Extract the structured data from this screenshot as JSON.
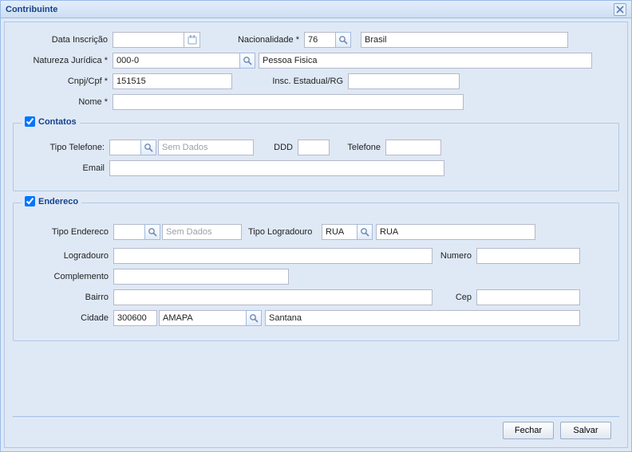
{
  "window": {
    "title": "Contribuinte"
  },
  "main": {
    "data_inscricao": {
      "label": "Data Inscrição",
      "value": ""
    },
    "nacionalidade": {
      "label": "Nacionalidade *",
      "code": "76",
      "name": "Brasil"
    },
    "natureza": {
      "label": "Natureza Jurídica *",
      "code": "000-0",
      "name": "Pessoa Fisica"
    },
    "cnpjcpf": {
      "label": "Cnpj/Cpf *",
      "value": "151515"
    },
    "insc": {
      "label": "Insc. Estadual/RG",
      "value": ""
    },
    "nome": {
      "label": "Nome *",
      "value": ""
    }
  },
  "contatos": {
    "legend": "Contatos",
    "checked": true,
    "tipo_telefone": {
      "label": "Tipo Telefone:",
      "code": "",
      "placeholder": "Sem Dados"
    },
    "ddd": {
      "label": "DDD",
      "value": ""
    },
    "telefone": {
      "label": "Telefone",
      "value": ""
    },
    "email": {
      "label": "Email",
      "value": ""
    }
  },
  "endereco": {
    "legend": "Endereco",
    "checked": true,
    "tipo_endereco": {
      "label": "Tipo Endereco",
      "code": "",
      "placeholder": "Sem Dados"
    },
    "tipo_logradouro": {
      "label": "Tipo Logradouro",
      "code": "RUA",
      "name": "RUA"
    },
    "logradouro": {
      "label": "Logradouro",
      "value": ""
    },
    "numero": {
      "label": "Numero",
      "value": ""
    },
    "complemento": {
      "label": "Complemento",
      "value": ""
    },
    "bairro": {
      "label": "Bairro",
      "value": ""
    },
    "cep": {
      "label": "Cep",
      "value": ""
    },
    "cidade": {
      "label": "Cidade",
      "code": "300600",
      "uf": "AMAPA",
      "name": "Santana"
    }
  },
  "footer": {
    "fechar": "Fechar",
    "salvar": "Salvar"
  }
}
